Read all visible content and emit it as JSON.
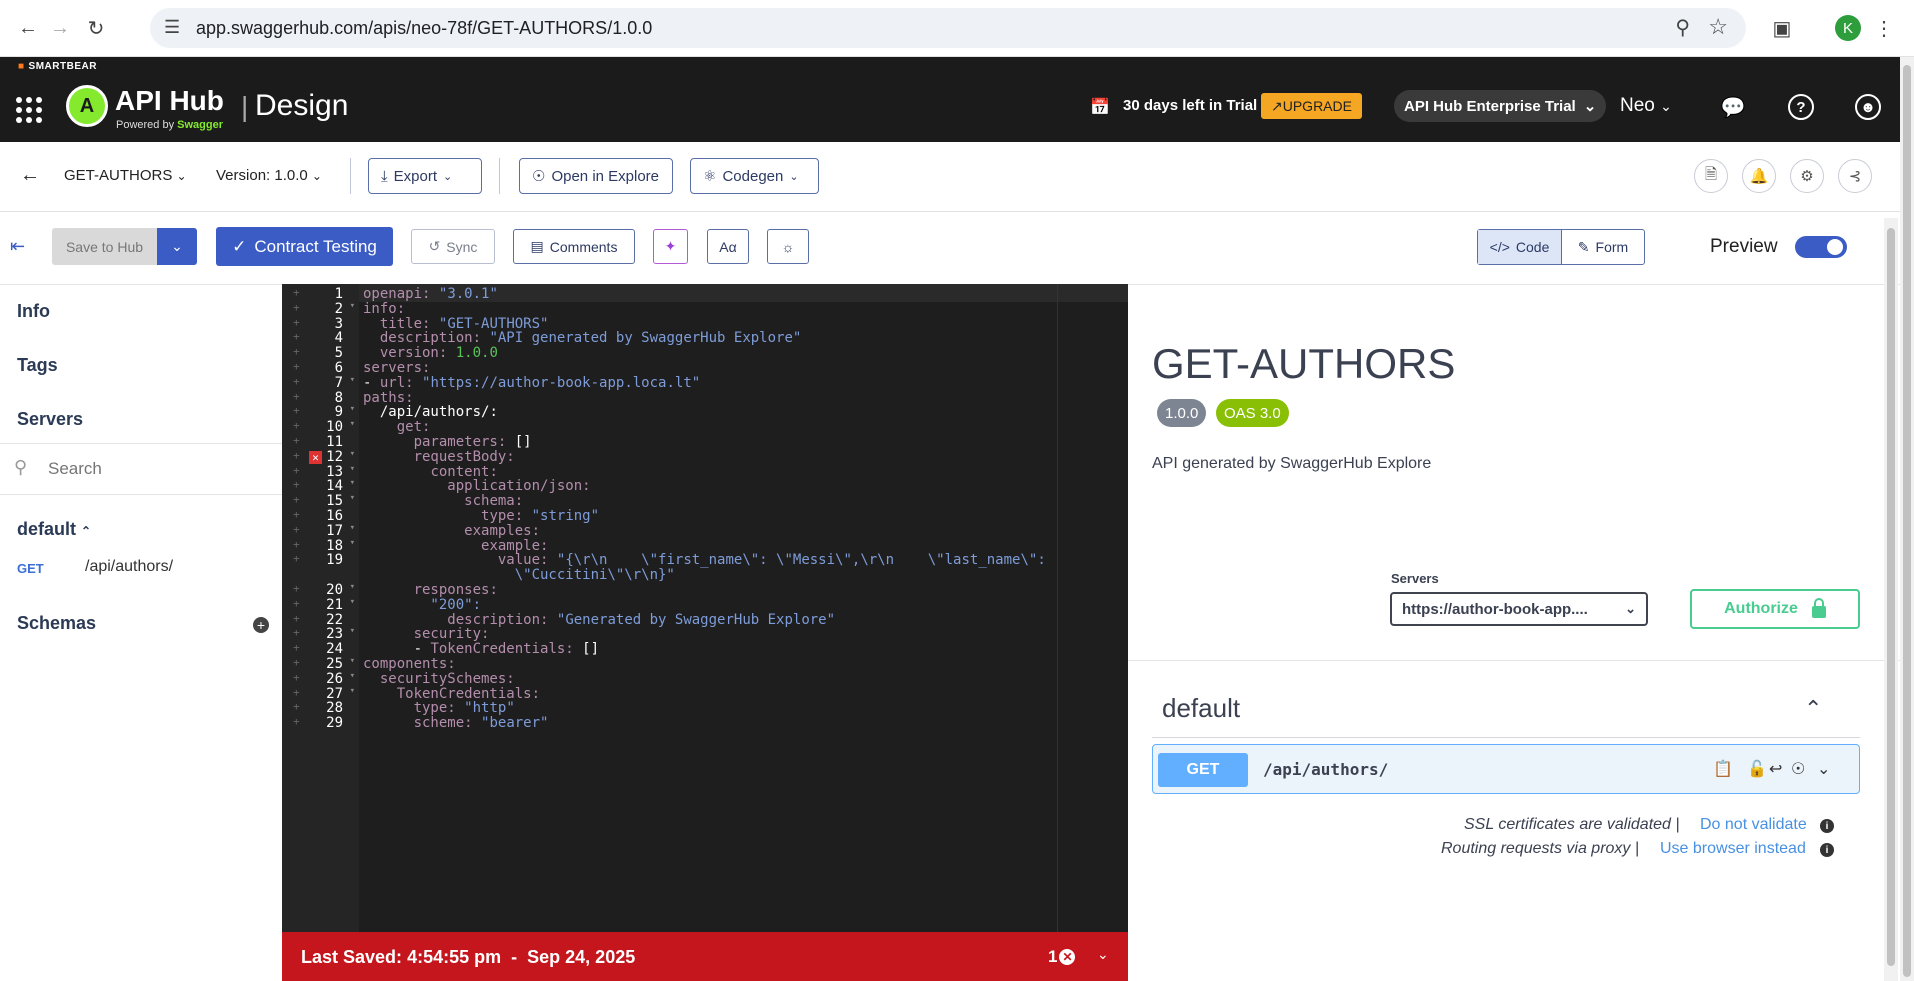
{
  "browser": {
    "url": "app.swaggerhub.com/apis/neo-78f/GET-AUTHORS/1.0.0",
    "profile_initial": "K"
  },
  "header": {
    "smartbear": "SMARTBEAR",
    "logo_letter": "A",
    "app_name": "API Hub",
    "powered_by": "Powered by",
    "powered_brand": "Swagger",
    "separator": "|",
    "section": "Design",
    "trial_text": "30 days left in Trial",
    "upgrade_label": "UPGRADE",
    "plan_label": "API Hub Enterprise Trial",
    "user_label": "Neo"
  },
  "toolbar1": {
    "api_name": "GET-AUTHORS",
    "version_label": "Version: 1.0.0",
    "export_label": "Export",
    "open_explore_label": "Open in Explore",
    "codegen_label": "Codegen"
  },
  "toolbar2": {
    "save_label": "Save to Hub",
    "contract_label": "Contract Testing",
    "sync_label": "Sync",
    "comments_label": "Comments",
    "font_label": "Aα",
    "code_label": "Code",
    "form_label": "Form",
    "preview_label": "Preview",
    "preview_on": true
  },
  "leftnav": {
    "info": "Info",
    "tags": "Tags",
    "servers": "Servers",
    "search_placeholder": "Search",
    "group": "default",
    "op_method": "GET",
    "op_path": "/api/authors/",
    "schemas": "Schemas"
  },
  "editor": {
    "lines": [
      {
        "n": "1",
        "text": "openapi: \"3.0.1\""
      },
      {
        "n": "2",
        "text": "info:"
      },
      {
        "n": "3",
        "text": "  title: \"GET-AUTHORS\""
      },
      {
        "n": "4",
        "text": "  description: \"API generated by SwaggerHub Explore\""
      },
      {
        "n": "5",
        "text": "  version: 1.0.0"
      },
      {
        "n": "6",
        "text": "servers:"
      },
      {
        "n": "7",
        "text": "- url: \"https://author-book-app.loca.lt\""
      },
      {
        "n": "8",
        "text": "paths:"
      },
      {
        "n": "9",
        "text": "  /api/authors/:"
      },
      {
        "n": "10",
        "text": "    get:"
      },
      {
        "n": "11",
        "text": "      parameters: []"
      },
      {
        "n": "12",
        "text": "      requestBody:"
      },
      {
        "n": "13",
        "text": "        content:"
      },
      {
        "n": "14",
        "text": "          application/json:"
      },
      {
        "n": "15",
        "text": "            schema:"
      },
      {
        "n": "16",
        "text": "              type: \"string\""
      },
      {
        "n": "17",
        "text": "            examples:"
      },
      {
        "n": "18",
        "text": "              example:"
      },
      {
        "n": "19",
        "text": "                value: \"{\\r\\n    \\\"first_name\\\": \\\"Messi\\\",\\r\\n    \\\"last_name\\\":"
      },
      {
        "n": "",
        "text": "                  \\\"Cuccitini\\\"\\r\\n}\""
      },
      {
        "n": "20",
        "text": "      responses:"
      },
      {
        "n": "21",
        "text": "        \"200\":"
      },
      {
        "n": "22",
        "text": "          description: \"Generated by SwaggerHub Explore\""
      },
      {
        "n": "23",
        "text": "      security:"
      },
      {
        "n": "24",
        "text": "      - TokenCredentials: []"
      },
      {
        "n": "25",
        "text": "components:"
      },
      {
        "n": "26",
        "text": "  securitySchemes:"
      },
      {
        "n": "27",
        "text": "    TokenCredentials:"
      },
      {
        "n": "28",
        "text": "      type: \"http\""
      },
      {
        "n": "29",
        "text": "      scheme: \"bearer\""
      }
    ],
    "error_line": "12",
    "foldable_lines": [
      "2",
      "7",
      "9",
      "10",
      "12",
      "13",
      "14",
      "15",
      "17",
      "18",
      "20",
      "21",
      "23",
      "25",
      "26",
      "27"
    ]
  },
  "status": {
    "saved_label": "Last Saved:",
    "saved_time": "4:54:55 pm",
    "dash": "-",
    "saved_date": "Sep 24, 2025",
    "error_count": "1"
  },
  "preview": {
    "title": "GET-AUTHORS",
    "version_badge": "1.0.0",
    "oas_badge": "OAS 3.0",
    "description": "API generated by SwaggerHub Explore",
    "servers_label": "Servers",
    "server_value": "https://author-book-app....",
    "authorize_label": "Authorize",
    "tag_name": "default",
    "op_method": "GET",
    "op_path": "/api/authors/",
    "ssl_text": "SSL certificates are validated |",
    "ssl_link": "Do not validate",
    "proxy_text": "Routing requests via proxy |",
    "proxy_link": "Use browser instead"
  },
  "colors": {
    "accent": "#3b5cc4",
    "get_method": "#61affe",
    "authorize": "#49cc90",
    "oas_badge": "#89bf04",
    "version_badge": "#7d8492",
    "status_error": "#c4161c",
    "upgrade": "#f5a623"
  }
}
